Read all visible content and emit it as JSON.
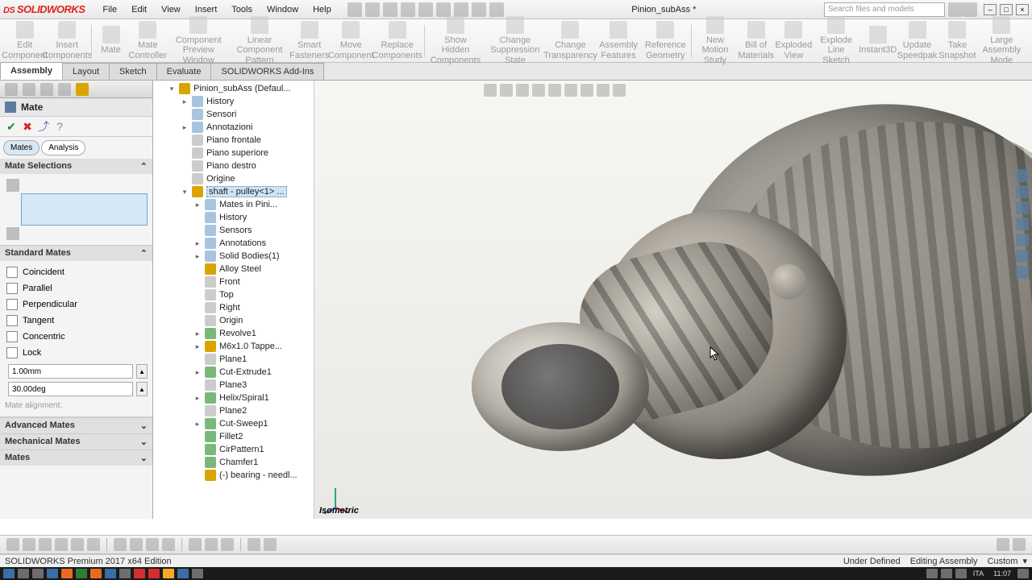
{
  "app": {
    "name": "SOLIDWORKS",
    "doc_title": "Pinion_subAss *",
    "search_placeholder": "Search files and models"
  },
  "menu": [
    "File",
    "Edit",
    "View",
    "Insert",
    "Tools",
    "Window",
    "Help"
  ],
  "ribbon": [
    "Edit Component",
    "Insert Components",
    "Mate",
    "Mate Controller",
    "Component Preview Window",
    "Linear Component Pattern",
    "Smart Fasteners",
    "Move Component",
    "Replace Components",
    "Show Hidden Components",
    "Change Suppression State",
    "Change Transparency",
    "Assembly Features",
    "Reference Geometry",
    "New Motion Study",
    "Bill of Materials",
    "Exploded View",
    "Explode Line Sketch",
    "Instant3D",
    "Update Speedpak",
    "Take Snapshot",
    "Large Assembly Mode"
  ],
  "tabs": [
    "Assembly",
    "Layout",
    "Sketch",
    "Evaluate",
    "SOLIDWORKS Add-Ins"
  ],
  "tabs_active": 0,
  "pm": {
    "title": "Mate",
    "subtabs": [
      "Mates",
      "Analysis"
    ],
    "sections": {
      "mate_selections": "Mate Selections",
      "standard": "Standard Mates",
      "advanced": "Advanced Mates",
      "mechanical": "Mechanical Mates",
      "mates": "Mates"
    },
    "std_mates": [
      "Coincident",
      "Parallel",
      "Perpendicular",
      "Tangent",
      "Concentric",
      "Lock"
    ],
    "dist": "1.00mm",
    "angle": "30.00deg",
    "align": "Mate alignment:"
  },
  "tree": {
    "root": "Pinion_subAss  (Defaul...",
    "root_children": [
      "History",
      "Sensori",
      "Annotazioni",
      "Piano frontale",
      "Piano superiore",
      "Piano destro",
      "Origine"
    ],
    "selected": "shaft - pulley<1> ...",
    "sel_children": [
      "Mates in Pini...",
      "History",
      "Sensors",
      "Annotations",
      "Solid Bodies(1)",
      "Alloy Steel",
      "Front",
      "Top",
      "Right",
      "Origin",
      "Revolve1",
      "M6x1.0 Tappe...",
      "Plane1",
      "Cut-Extrude1",
      "Plane3",
      "Helix/Spiral1",
      "Plane2",
      "Cut-Sweep1",
      "Fillet2",
      "CirPattern1",
      "Chamfer1",
      "(-) bearing - needl..."
    ],
    "view_label": "Isometric"
  },
  "status": {
    "left": "SOLIDWORKS Premium 2017 x64 Edition",
    "state": "Under Defined",
    "mode": "Editing Assembly",
    "units": "Custom"
  },
  "taskbar": {
    "lang": "ITA",
    "time": "11:07"
  }
}
